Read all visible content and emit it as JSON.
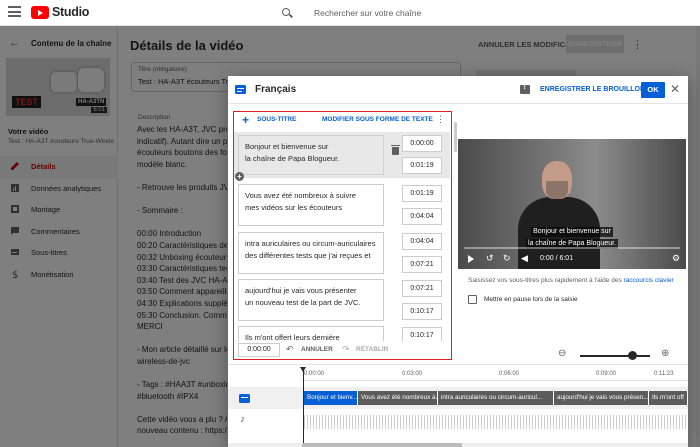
{
  "app": {
    "title": "Studio",
    "search_placeholder": "Rechercher sur votre chaîne"
  },
  "sidebar": {
    "back_label": "Contenu de la chaîne",
    "thumbnail": {
      "badge": "TEST",
      "model": "HA-A3TN",
      "duration": "6:01"
    },
    "your_video_label": "Votre vidéo",
    "video_subtitle": "Test : HA-A3T écouteurs True-Wirele...",
    "items": [
      {
        "label": "Détails",
        "icon": "pencil-icon",
        "active": true
      },
      {
        "label": "Données analytiques",
        "icon": "analytics-icon",
        "active": false
      },
      {
        "label": "Montage",
        "icon": "film-icon",
        "active": false
      },
      {
        "label": "Commentaires",
        "icon": "comment-icon",
        "active": false
      },
      {
        "label": "Sous-titres",
        "icon": "subtitles-icon",
        "active": false
      },
      {
        "label": "Monétisation",
        "icon": "dollar-icon",
        "active": false
      }
    ]
  },
  "main": {
    "title": "Détails de la vidéo",
    "undo_label": "ANNULER LES MODIFICATIONS",
    "save_label": "ENREGISTRER",
    "title_field_label": "Titre (obligatoire)",
    "title_field_value": "Test : HA-A3T écouteurs Tru",
    "description_label": "Description",
    "description_lines": [
      "Avec les HA-A3T, JVC propo",
      "indicatif). Autant dire un prix",
      "écouteurs boutons des fonct",
      "modèle blanc.",
      "",
      "- Retrouve les produits JVC",
      "",
      "- Sommaire :",
      "",
      "00:00 Introduction",
      "00:20 Caractéristiques des",
      "00:32 Unboxing écouteurs J",
      "03:30 Caractéristiques techn",
      "03:40 Test des JVC HA-A3T",
      "03:50 Comment appareiller l",
      "04:30 Explications suppléme",
      "05:30 Conclusion. Comment",
      "MERCI",
      "",
      "- Mon article détaillé sur le",
      "wireless-de-jvc",
      "",
      "- Tags : #HAA3T #unboxing",
      "#bluetooth #IPX4",
      "",
      "Cette vidéo vous a plu ? Ab",
      "nouveau contenu : https://w"
    ]
  },
  "dialog": {
    "title": "Français",
    "save_draft_label": "ENREGISTRER LE BROUILLON",
    "ok_label": "OK",
    "editor": {
      "add_label": "SOUS-TITRE",
      "edit_as_text_label": "MODIFIER SOUS FORME DE TEXTE",
      "cues": [
        {
          "text": "Bonjour et bienvenue sur\nla chaîne de Papa Blogueur.",
          "start": "0:00:00",
          "end": "0:01:19",
          "selected": true
        },
        {
          "text": "Vous avez été nombreux à suivre\nmes vidéos sur les écouteurs",
          "start": "0:01:19",
          "end": "0:04:04",
          "selected": false
        },
        {
          "text": "intra auriculaires ou circum-auriculaires\ndes différentes tests que j'ai reçues et",
          "start": "0:04:04",
          "end": "0:07:21",
          "selected": false
        },
        {
          "text": "aujourd'hui je vais vous présenter\nun nouveau test de la part de JVC.",
          "start": "0:07:21",
          "end": "0:10:17",
          "selected": false
        },
        {
          "text": "Ils m'ont offert leurs dernière",
          "start": "0:10:17",
          "end": "",
          "selected": false
        }
      ],
      "footer_time": "0:00:00",
      "undo_label": "ANNULER",
      "redo_label": "RÉTABLIR"
    },
    "video": {
      "caption_line1": "Bonjour et bienvenue sur",
      "caption_line2": "la chaîne de Papa Blogueur.",
      "time": "0:00 / 6:01"
    },
    "hint_text": "Saisissez vos sous-titres plus rapidement à l'aide des",
    "hint_link": "raccourcis clavier",
    "pause_label": "Mettre en pause lors de la saisie",
    "timeline": {
      "ticks": [
        "0:00:00",
        "0:03:00",
        "0:06:00",
        "0:09:00",
        "0:11:23"
      ],
      "segments": [
        "Bonjour et bienv...",
        "Vous avez été nombreux à...",
        "intra auriculaires ou circum-auricul...",
        "aujourd'hui je vais vous présen...",
        "Ils m'ont off"
      ]
    }
  }
}
